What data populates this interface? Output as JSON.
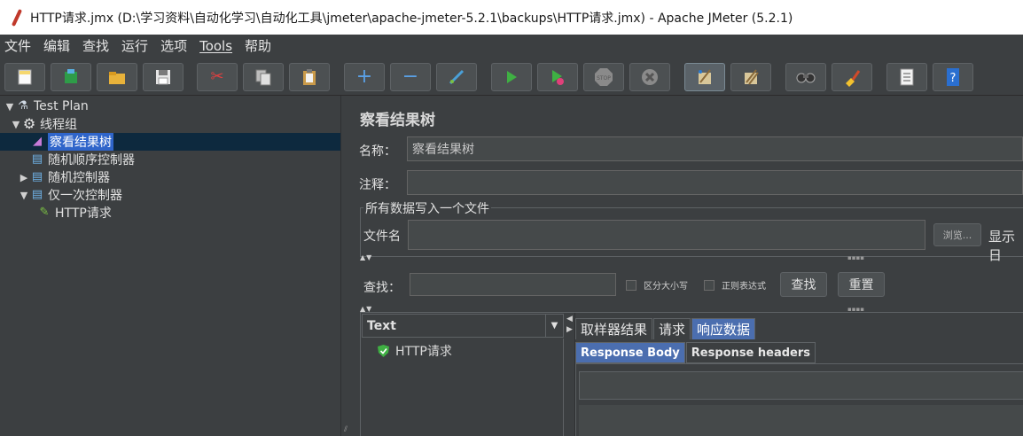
{
  "window": {
    "title": "HTTP请求.jmx (D:\\学习资料\\自动化学习\\自动化工具\\jmeter\\apache-jmeter-5.2.1\\backups\\HTTP请求.jmx) - Apache JMeter (5.2.1)"
  },
  "menu": {
    "items": [
      "文件",
      "编辑",
      "查找",
      "运行",
      "选项",
      "Tools",
      "帮助"
    ]
  },
  "toolbar": {
    "buttons": [
      {
        "name": "new-icon",
        "glyph": "▭"
      },
      {
        "name": "templates-icon",
        "glyph": "▤"
      },
      {
        "name": "open-icon",
        "glyph": "▰"
      },
      {
        "name": "save-icon",
        "glyph": "▣"
      },
      {
        "name": "cut-icon",
        "glyph": "✂"
      },
      {
        "name": "copy-icon",
        "glyph": "❐"
      },
      {
        "name": "paste-icon",
        "glyph": "▥"
      },
      {
        "name": "expand-icon",
        "glyph": "+"
      },
      {
        "name": "collapse-icon",
        "glyph": "−"
      },
      {
        "name": "toggle-icon",
        "glyph": "⟋"
      },
      {
        "name": "start-icon",
        "glyph": "▶"
      },
      {
        "name": "start-no-pauses-icon",
        "glyph": "▶"
      },
      {
        "name": "stop-icon",
        "glyph": "⬣"
      },
      {
        "name": "shutdown-icon",
        "glyph": "✖"
      },
      {
        "name": "clear-icon",
        "glyph": "⚘"
      },
      {
        "name": "clear-all-icon",
        "glyph": "⚘"
      },
      {
        "name": "search-icon",
        "glyph": "∞"
      },
      {
        "name": "reset-search-icon",
        "glyph": "✎"
      },
      {
        "name": "function-helper-icon",
        "glyph": "☰"
      },
      {
        "name": "help-icon",
        "glyph": "?"
      }
    ]
  },
  "tree": {
    "items": [
      {
        "label": "Test Plan",
        "arrow": "▼",
        "icon": "⚗"
      },
      {
        "label": "线程组",
        "arrow": "▼",
        "icon": "⚙"
      },
      {
        "label": "察看结果树",
        "arrow": "",
        "icon": "◢"
      },
      {
        "label": "随机顺序控制器",
        "arrow": "",
        "icon": "▤"
      },
      {
        "label": "随机控制器",
        "arrow": "▶",
        "icon": "▤"
      },
      {
        "label": "仅一次控制器",
        "arrow": "▼",
        "icon": "▤"
      },
      {
        "label": "HTTP请求",
        "arrow": "",
        "icon": "✎"
      }
    ]
  },
  "panel": {
    "title": "察看结果树",
    "name_label": "名称：",
    "name_value": "察看结果树",
    "comment_label": "注释：",
    "comment_value": "",
    "group_title": "所有数据写入一个文件",
    "file_label": "文件名",
    "file_value": "",
    "browse_button": "浏览...",
    "display_label": "显示日",
    "search_label": "查找：",
    "search_value": "",
    "case_sensitive": "区分大小写",
    "regex": "正则表达式",
    "find_button": "查找",
    "reset_button": "重置"
  },
  "results": {
    "renderer": "Text",
    "items": [
      "HTTP请求"
    ],
    "tabs": [
      "取样器结果",
      "请求",
      "响应数据"
    ],
    "active_tab": "响应数据",
    "subtabs": [
      "Response Body",
      "Response headers"
    ],
    "active_subtab": "Response Body"
  },
  "colors": {
    "background": "#3c3f41",
    "selection": "#2f65ca",
    "tab_active": "#4b6eaf",
    "success": "#3fb043"
  }
}
